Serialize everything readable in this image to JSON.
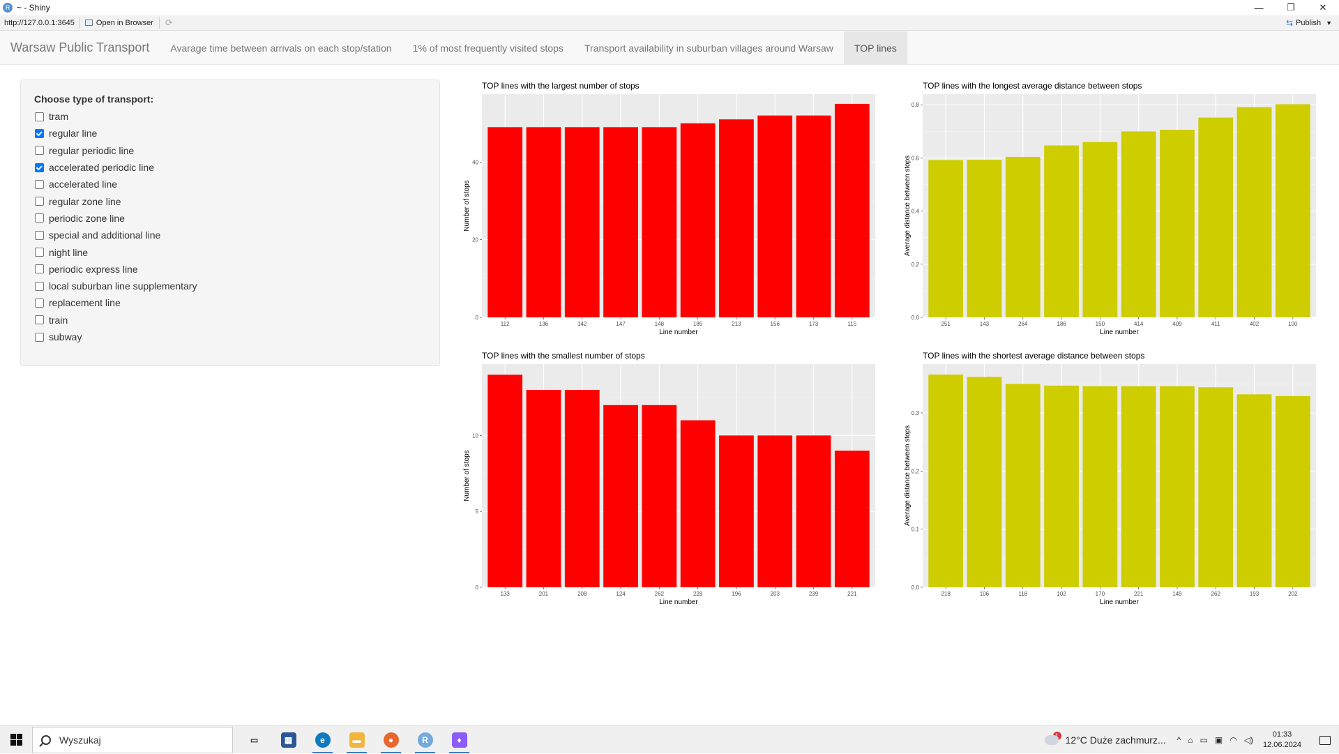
{
  "window": {
    "app_icon": "R",
    "title": "~ - Shiny",
    "controls": [
      "—",
      "❐",
      "✕"
    ]
  },
  "addressbar": {
    "url": "http://127.0.0.1:3645",
    "open_in_browser": "Open in Browser",
    "publish": "Publish"
  },
  "navbar": {
    "brand": "Warsaw Public Transport",
    "tabs": [
      {
        "label": "Avarage time between arrivals on each stop/station",
        "active": false
      },
      {
        "label": "1% of most frequently visited stops",
        "active": false
      },
      {
        "label": "Transport availability in suburban villages around Warsaw",
        "active": false
      },
      {
        "label": "TOP lines",
        "active": true
      }
    ]
  },
  "sidebar": {
    "label": "Choose type of transport:",
    "options": [
      {
        "label": "tram",
        "checked": false
      },
      {
        "label": "regular line",
        "checked": true
      },
      {
        "label": "regular periodic line",
        "checked": false
      },
      {
        "label": "accelerated periodic line",
        "checked": true
      },
      {
        "label": "accelerated line",
        "checked": false
      },
      {
        "label": "regular zone line",
        "checked": false
      },
      {
        "label": "periodic zone line",
        "checked": false
      },
      {
        "label": "special and additional line",
        "checked": false
      },
      {
        "label": "night line",
        "checked": false
      },
      {
        "label": "periodic express line",
        "checked": false
      },
      {
        "label": "local suburban line supplementary",
        "checked": false
      },
      {
        "label": "replacement line",
        "checked": false
      },
      {
        "label": "train",
        "checked": false
      },
      {
        "label": "subway",
        "checked": false
      }
    ]
  },
  "chart_data": [
    {
      "type": "bar",
      "title": "TOP lines with the largest number of stops",
      "xlabel": "Line number",
      "ylabel": "Number of stops",
      "categories": [
        "112",
        "136",
        "142",
        "147",
        "148",
        "185",
        "213",
        "156",
        "173",
        "115"
      ],
      "values": [
        49,
        49,
        49,
        49,
        49,
        50,
        51,
        52,
        52,
        55
      ],
      "yticks": [
        0,
        20,
        40
      ],
      "ytick_labels": [
        "0",
        "20",
        "40"
      ],
      "ylim": [
        0,
        57.5
      ],
      "color": "#ff0000",
      "grid": true
    },
    {
      "type": "bar",
      "title": "TOP lines with the longest average distance between stops",
      "xlabel": "Line number",
      "ylabel": "Average distance between stops",
      "categories": [
        "251",
        "143",
        "264",
        "186",
        "150",
        "414",
        "409",
        "411",
        "402",
        "100"
      ],
      "values": [
        0.592,
        0.593,
        0.604,
        0.647,
        0.66,
        0.7,
        0.706,
        0.752,
        0.791,
        0.802
      ],
      "yticks": [
        0.0,
        0.2,
        0.4,
        0.6,
        0.8
      ],
      "ytick_labels": [
        "0.0",
        "0.2",
        "0.4",
        "0.6",
        "0.8"
      ],
      "ylim": [
        0,
        0.84
      ],
      "color": "#cdcd00",
      "grid": true
    },
    {
      "type": "bar",
      "title": "TOP lines with the smallest number of stops",
      "xlabel": "Line number",
      "ylabel": "Number of stops",
      "categories": [
        "133",
        "201",
        "208",
        "124",
        "262",
        "228",
        "196",
        "203",
        "239",
        "221"
      ],
      "values": [
        14,
        13,
        13,
        12,
        12,
        11,
        10,
        10,
        10,
        9
      ],
      "yticks": [
        0,
        5,
        10
      ],
      "ytick_labels": [
        "0",
        "5",
        "10"
      ],
      "ylim": [
        0,
        14.7
      ],
      "color": "#ff0000",
      "grid": true
    },
    {
      "type": "bar",
      "title": "TOP lines with the shortest average distance between stops",
      "xlabel": "Line number",
      "ylabel": "Average distance between stops",
      "categories": [
        "218",
        "106",
        "118",
        "102",
        "170",
        "221",
        "149",
        "262",
        "193",
        "202"
      ],
      "values": [
        0.366,
        0.362,
        0.35,
        0.347,
        0.346,
        0.346,
        0.346,
        0.344,
        0.332,
        0.329
      ],
      "yticks": [
        0.0,
        0.1,
        0.2,
        0.3
      ],
      "ytick_labels": [
        "0.0",
        "0.1",
        "0.2",
        "0.3"
      ],
      "ylim": [
        0,
        0.384
      ],
      "color": "#cdcd00",
      "grid": true
    }
  ],
  "taskbar": {
    "search_placeholder": "Wyszukaj",
    "apps": [
      {
        "name": "task-view",
        "glyph": "▭",
        "color": "#333333",
        "running": false
      },
      {
        "name": "store",
        "glyph": "▦",
        "color": "#2b5797",
        "running": false
      },
      {
        "name": "edge",
        "glyph": "e",
        "color": "#0f7bbf",
        "running": true
      },
      {
        "name": "file-explorer",
        "glyph": "▬",
        "color": "#f2b63c",
        "running": true
      },
      {
        "name": "firefox",
        "glyph": "●",
        "color": "#e8672f",
        "running": true
      },
      {
        "name": "rstudio",
        "glyph": "R",
        "color": "#75a9da",
        "running": true
      },
      {
        "name": "flame-app",
        "glyph": "♦",
        "color": "#8b5cf6",
        "running": true
      }
    ],
    "weather_badge": "1",
    "weather": "12°C  Duże zachmurz...",
    "tray_icons": [
      "^",
      "⌂",
      "▭",
      "▣",
      "◠",
      "◁)"
    ],
    "time": "01:33",
    "date": "12.06.2024"
  }
}
